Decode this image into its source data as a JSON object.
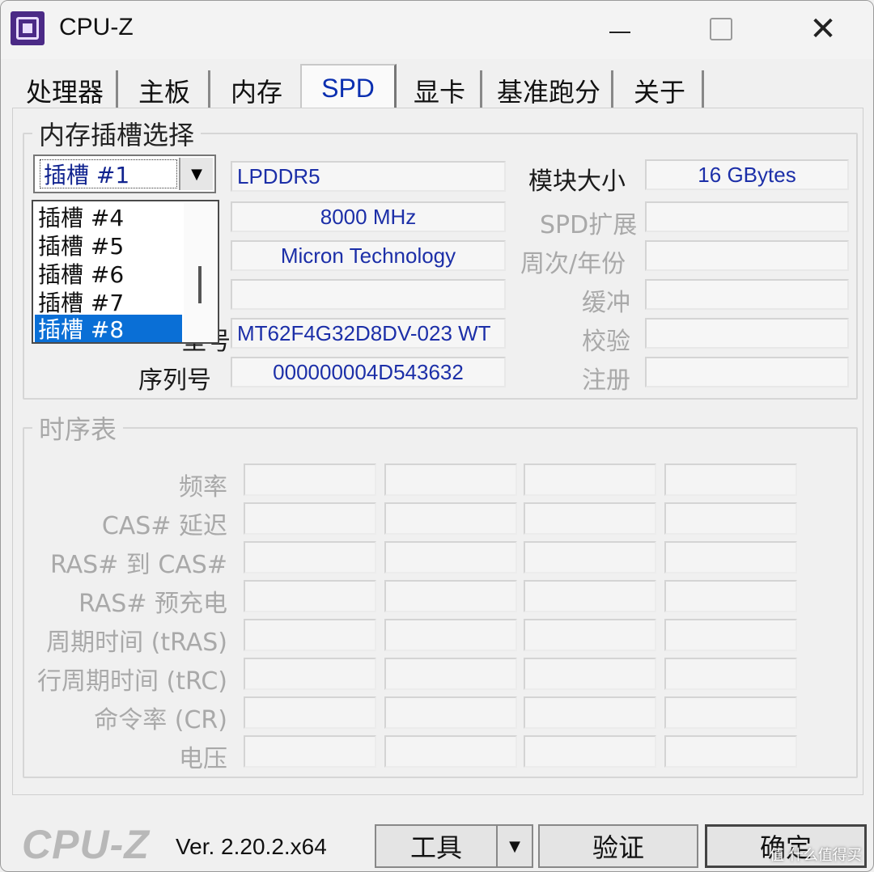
{
  "window": {
    "title": "CPU-Z",
    "close_glyph": "✕"
  },
  "tabs": [
    "处理器",
    "主板",
    "内存",
    "SPD",
    "显卡",
    "基准跑分",
    "关于"
  ],
  "slot_group": {
    "legend": "内存插槽选择",
    "selected_slot": "插槽 #1",
    "dropdown_items": [
      "插槽 #4",
      "插槽 #5",
      "插槽 #6",
      "插槽 #7",
      "插槽 #8"
    ],
    "highlighted_item": "插槽 #8",
    "type": "LPDDR5",
    "max_bandwidth": "8000 MHz",
    "manufacturer": "Micron Technology",
    "dram_manufacturer": "",
    "part_label_partial": "型号",
    "part_number": "MT62F4G32D8DV-023 WT",
    "serial_label": "序列号",
    "serial_number": "000000004D543632",
    "right_labels": {
      "module_size": "模块大小",
      "spd_ext": "SPD扩展",
      "week_year": "周次/年份",
      "buffered": "缓冲",
      "correction": "校验",
      "registered": "注册"
    },
    "module_size": "16 GBytes"
  },
  "timing_group": {
    "legend": "时序表",
    "rows": [
      "频率",
      "CAS# 延迟",
      "RAS# 到 CAS#",
      "RAS# 预充电",
      "周期时间 (tRAS)",
      "行周期时间 (tRC)",
      "命令率 (CR)",
      "电压"
    ]
  },
  "footer": {
    "logo": "CPU-Z",
    "version": "Ver. 2.20.2.x64",
    "tools": "工具",
    "validate": "验证",
    "ok": "确定",
    "watermark": "值 什么值得买"
  }
}
